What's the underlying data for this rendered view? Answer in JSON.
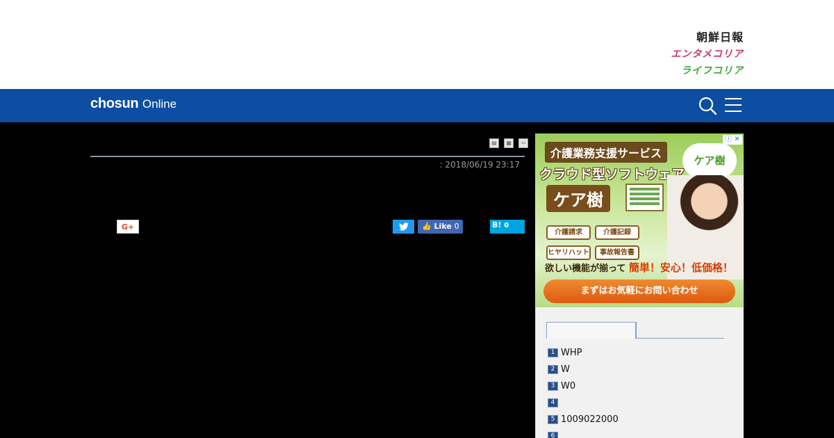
{
  "header": {
    "brand_links": [
      "朝鮮日報",
      "エンタメコリア",
      "ライフコリア"
    ]
  },
  "navbar": {
    "logo_bold": "chosun",
    "logo_light": "Online",
    "search_icon": "search-icon",
    "menu_icon": "hamburger-menu-icon"
  },
  "article": {
    "tools": [
      "print-icon",
      "text-size-icon",
      "back-icon"
    ],
    "date": ": 2018/06/19 23:17",
    "share": {
      "gplus_label": "G+",
      "fb_label": "Like",
      "fb_count": "0",
      "hatena_label": "B!",
      "hatena_count": "0"
    }
  },
  "ad": {
    "headline": "介護業務支援サービス",
    "logo": "ケア樹",
    "subhead": "クラウド型ソフトウェア",
    "product": "ケア樹",
    "tags": [
      "介護請求",
      "介護記録",
      "ヒヤリハット",
      "事故報告書"
    ],
    "tagline_a": "欲しい機能が揃って",
    "tagline_b": "簡単！安心！低価格！",
    "cta": "まずはお気軽にお問い合わせ"
  },
  "ranking": {
    "items": [
      {
        "num": "1",
        "text": "WHP"
      },
      {
        "num": "2",
        "text": "W"
      },
      {
        "num": "3",
        "text": "W0"
      },
      {
        "num": "4",
        "text": ""
      },
      {
        "num": "5",
        "text": "1009022000"
      },
      {
        "num": "6",
        "text": ""
      }
    ]
  }
}
